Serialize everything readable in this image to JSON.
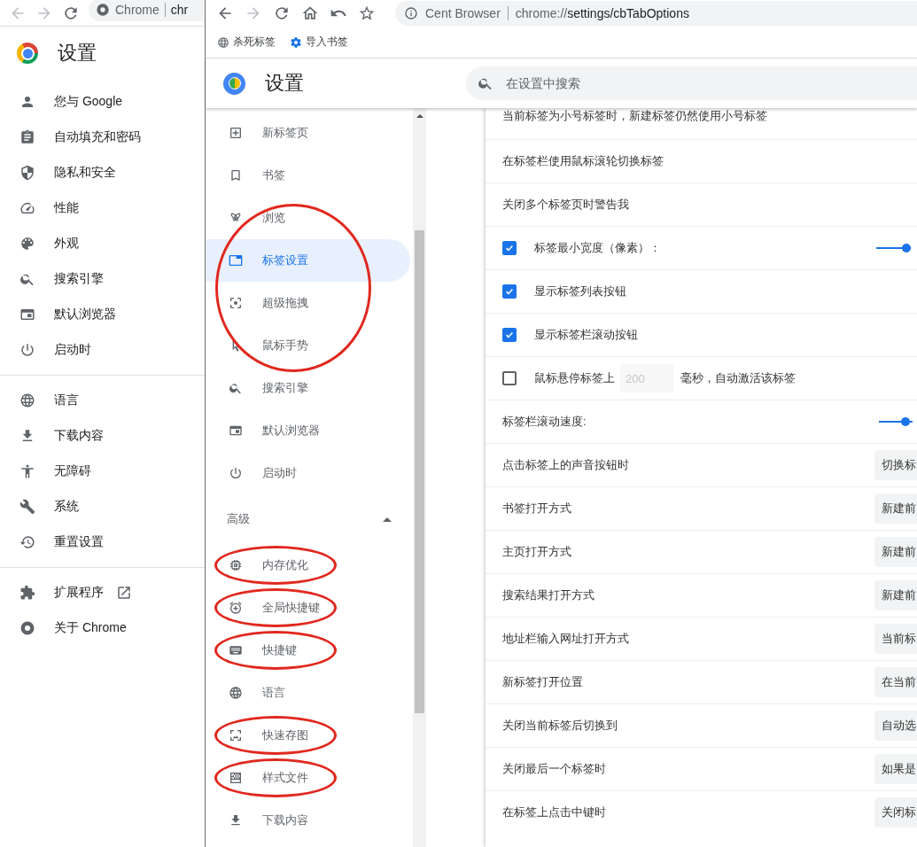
{
  "back_window": {
    "toolbar": {
      "site": "Chrome",
      "url": "chr"
    },
    "page_title": "设置",
    "nav_groups": [
      {
        "items": [
          {
            "label": "您与 Google",
            "selected": false,
            "external": false
          },
          {
            "label": "自动填充和密码",
            "selected": false,
            "external": false
          },
          {
            "label": "隐私和安全",
            "selected": false,
            "external": false
          },
          {
            "label": "性能",
            "selected": false,
            "external": false
          },
          {
            "label": "外观",
            "selected": false,
            "external": false
          },
          {
            "label": "搜索引擎",
            "selected": false,
            "external": false
          },
          {
            "label": "默认浏览器",
            "selected": false,
            "external": false
          },
          {
            "label": "启动时",
            "selected": false,
            "external": false
          }
        ]
      },
      {
        "items": [
          {
            "label": "语言",
            "selected": false,
            "external": false
          },
          {
            "label": "下载内容",
            "selected": false,
            "external": false
          },
          {
            "label": "无障碍",
            "selected": false,
            "external": false
          },
          {
            "label": "系统",
            "selected": false,
            "external": false
          },
          {
            "label": "重置设置",
            "selected": false,
            "external": false
          }
        ]
      },
      {
        "items": [
          {
            "label": "扩展程序",
            "selected": false,
            "external": true
          },
          {
            "label": "关于 Chrome",
            "selected": false,
            "external": false
          }
        ]
      }
    ]
  },
  "front_window": {
    "toolbar": {
      "site": "Cent Browser",
      "url_scheme": "chrome://",
      "url_rest": "settings/cbTabOptions"
    },
    "bookmarks": [
      {
        "label": "杀死标签"
      },
      {
        "label": "导入书签"
      }
    ],
    "page_title": "设置",
    "search": {
      "placeholder": "在设置中搜索"
    },
    "sidebar": {
      "groups": [
        {
          "circled": false,
          "items": [
            {
              "label": "新标签页",
              "selected": false
            },
            {
              "label": "书签",
              "selected": false
            }
          ]
        },
        {
          "circled": true,
          "items": [
            {
              "label": "浏览",
              "selected": false
            },
            {
              "label": "标签设置",
              "selected": true
            },
            {
              "label": "超级拖拽",
              "selected": false
            },
            {
              "label": "鼠标手势",
              "selected": false
            }
          ]
        },
        {
          "circled": false,
          "items": [
            {
              "label": "搜索引擎",
              "selected": false
            },
            {
              "label": "默认浏览器",
              "selected": false
            },
            {
              "label": "启动时",
              "selected": false
            }
          ]
        }
      ],
      "advanced": {
        "label": "高级",
        "expanded": true,
        "groups": [
          {
            "circled": true,
            "items": [
              {
                "label": "内存优化",
                "selected": false
              }
            ]
          },
          {
            "circled": true,
            "items": [
              {
                "label": "全局快捷键",
                "selected": false
              }
            ]
          },
          {
            "circled": true,
            "items": [
              {
                "label": "快捷键",
                "selected": false
              }
            ]
          },
          {
            "circled": false,
            "items": [
              {
                "label": "语言",
                "selected": false
              }
            ]
          },
          {
            "circled": true,
            "items": [
              {
                "label": "快速存图",
                "selected": false
              }
            ]
          },
          {
            "circled": true,
            "items": [
              {
                "label": "样式文件",
                "selected": false
              }
            ]
          },
          {
            "circled": false,
            "items": [
              {
                "label": "下载内容",
                "selected": false
              }
            ]
          }
        ]
      }
    },
    "rows": [
      {
        "kind": "text",
        "label": "当前标签为小号标签时，新建标签仍然使用小号标签"
      },
      {
        "kind": "text",
        "label": "在标签栏使用鼠标滚轮切换标签"
      },
      {
        "kind": "text",
        "label": "关闭多个标签页时警告我"
      },
      {
        "kind": "checkbox_slider",
        "label": "标签最小宽度（像素）：",
        "checked": true,
        "level": 0.85
      },
      {
        "kind": "checkbox",
        "label": "显示标签列表按钮",
        "checked": true
      },
      {
        "kind": "checkbox",
        "label": "显示标签栏滚动按钮",
        "checked": true
      },
      {
        "kind": "checkbox_input",
        "label": "鼠标悬停标签上",
        "placeholder": "200",
        "suffix": "毫秒，自动激活该标签",
        "checked": false
      },
      {
        "kind": "slider",
        "label": "标签栏滚动速度:",
        "level": 0.75
      },
      {
        "kind": "select",
        "label": "点击标签上的声音按钮时",
        "value": "切换标"
      },
      {
        "kind": "select",
        "label": "书签打开方式",
        "value": "新建前"
      },
      {
        "kind": "select",
        "label": "主页打开方式",
        "value": "新建前"
      },
      {
        "kind": "select",
        "label": "搜索结果打开方式",
        "value": "新建前"
      },
      {
        "kind": "select",
        "label": "地址栏输入网址打开方式",
        "value": "当前标"
      },
      {
        "kind": "select",
        "label": "新标签打开位置",
        "value": "在当前"
      },
      {
        "kind": "select",
        "label": "关闭当前标签后切换到",
        "value": "自动选"
      },
      {
        "kind": "select",
        "label": "关闭最后一个标签时",
        "value": "如果是"
      },
      {
        "kind": "select",
        "label": "在标签上点击中键时",
        "value": "关闭标"
      }
    ]
  }
}
